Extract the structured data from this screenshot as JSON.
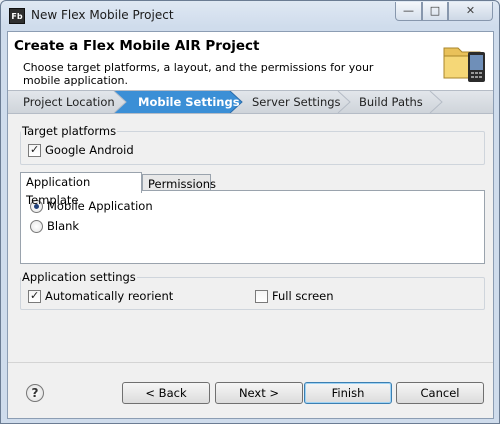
{
  "window": {
    "app_icon_text": "Fb",
    "title": "New Flex Mobile Project",
    "controls": {
      "minimize": "—",
      "maximize": "□",
      "close": "✕"
    }
  },
  "header": {
    "title": "Create a Flex Mobile AIR Project",
    "description": "Choose target platforms, a layout, and the permissions for your mobile application.",
    "graphic_icon": "folder-phone-icon"
  },
  "breadcrumbs": [
    {
      "label": "Project Location",
      "active": false
    },
    {
      "label": "Mobile Settings",
      "active": true
    },
    {
      "label": "Server Settings",
      "active": false
    },
    {
      "label": "Build Paths",
      "active": false
    }
  ],
  "target_platforms": {
    "label": "Target platforms",
    "google_android": {
      "label": "Google Android",
      "checked": true
    }
  },
  "tabs": [
    {
      "label": "Application Template",
      "active": true
    },
    {
      "label": "Permissions",
      "active": false
    }
  ],
  "template_options": [
    {
      "label": "Mobile Application",
      "selected": true
    },
    {
      "label": "Blank",
      "selected": false
    }
  ],
  "app_settings": {
    "label": "Application settings",
    "auto_reorient": {
      "label": "Automatically reorient",
      "checked": true
    },
    "full_screen": {
      "label": "Full screen",
      "checked": false
    }
  },
  "footer": {
    "help": "?",
    "back": "< Back",
    "next": "Next >",
    "finish": "Finish",
    "cancel": "Cancel"
  },
  "colors": {
    "active_crumb": "#3b8fd6",
    "window_frame": "#cfdcec"
  }
}
